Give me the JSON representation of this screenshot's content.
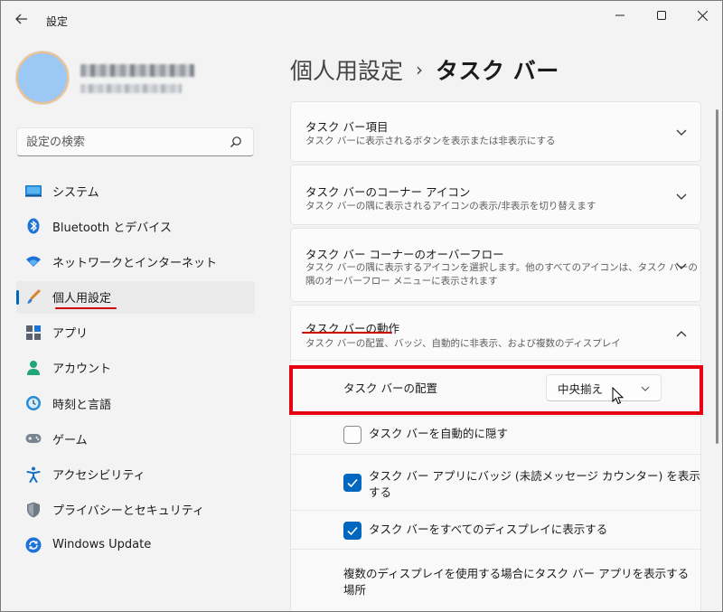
{
  "window": {
    "title": "設定",
    "controls": {
      "minimize": "—",
      "maximize": "☐",
      "close": "✕"
    }
  },
  "sidebar": {
    "search": {
      "placeholder": "設定の検索",
      "value": ""
    },
    "items": [
      {
        "label": "システム",
        "icon": "system-icon"
      },
      {
        "label": "Bluetooth とデバイス",
        "icon": "bluetooth-icon"
      },
      {
        "label": "ネットワークとインターネット",
        "icon": "network-icon"
      },
      {
        "label": "個人用設定",
        "icon": "personalization-icon",
        "selected": true
      },
      {
        "label": "アプリ",
        "icon": "apps-icon"
      },
      {
        "label": "アカウント",
        "icon": "account-icon"
      },
      {
        "label": "時刻と言語",
        "icon": "time-language-icon"
      },
      {
        "label": "ゲーム",
        "icon": "gaming-icon"
      },
      {
        "label": "アクセシビリティ",
        "icon": "accessibility-icon"
      },
      {
        "label": "プライバシーとセキュリティ",
        "icon": "privacy-icon"
      },
      {
        "label": "Windows Update",
        "icon": "windows-update-icon"
      }
    ]
  },
  "breadcrumb": {
    "parent": "個人用設定",
    "separator": "›",
    "current": "タスク バー"
  },
  "cards": [
    {
      "title": "タスク バー項目",
      "desc": "タスク バーに表示されるボタンを表示または非表示にする"
    },
    {
      "title": "タスク バーのコーナー アイコン",
      "desc": "タスク バーの隅に表示されるアイコンの表示/非表示を切り替えます"
    },
    {
      "title": "タスク バー コーナーのオーバーフロー",
      "desc1": "タスク バーの隅に表示するアイコンを選択します。他のすべてのアイコンは、タスク バーの",
      "desc2": "隅のオーバーフロー メニューに表示されます"
    },
    {
      "title": "タスク バーの動作",
      "desc": "タスク バーの配置、バッジ、自動的に非表示、および複数のディスプレイ"
    }
  ],
  "behavior": {
    "alignment_label": "タスク バーの配置",
    "alignment_value": "中央揃え",
    "autohide_label": "タスク バーを自動的に隠す",
    "autohide_checked": false,
    "badge_label1": "タスク バー アプリにバッジ (未読メッセージ カウンター) を表示",
    "badge_label2": "する",
    "badge_checked": true,
    "all_displays_label": "タスク バーをすべてのディスプレイに表示する",
    "all_displays_checked": true,
    "multi_display_label1": "複数のディスプレイを使用する場合にタスク バー アプリを表示する",
    "multi_display_label2": "場所"
  },
  "colors": {
    "accent": "#0067c0",
    "highlight": "#e60012",
    "underline": "#d10000"
  }
}
